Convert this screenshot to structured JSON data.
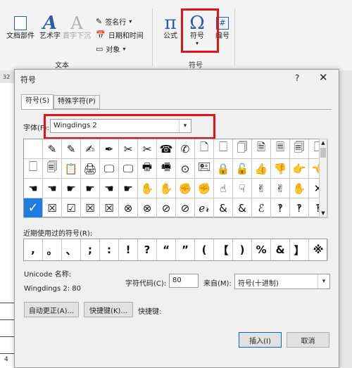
{
  "ribbon": {
    "doc_parts": "文档部件",
    "wordart": "艺术字",
    "dropcap": "首字下沉",
    "signature": "签名行",
    "datetime": "日期和时间",
    "object": "对象",
    "group_text": "文本",
    "equation": "公式",
    "symbol": "符号",
    "number": "编号",
    "group_symbols": "符号",
    "ruler_num": "32",
    "doc_frag": "4"
  },
  "dialog": {
    "title": "符号",
    "help": "?",
    "close": "✕",
    "tabs": [
      "符号(S)",
      "特殊字符(P)"
    ],
    "font_label": "字体(F):",
    "font_value": "Wingdings 2",
    "grid_rows": [
      [
        "",
        "✎",
        "✎",
        "✍",
        "✒",
        "✂",
        "✂",
        "☎",
        "✆",
        "🗋",
        "🗌",
        "🗍",
        "🗎",
        "🗏",
        "🗐",
        "🗋"
      ],
      [
        "🗌",
        "🗐",
        "📋",
        "🖨",
        "🖵",
        "🖵",
        "🖶",
        "🖷",
        "⊙",
        "🖭",
        "🔒",
        "🔓",
        "👍",
        "👎",
        "👉",
        "👈"
      ],
      [
        "☚",
        "☚",
        "☛",
        "☛",
        "☚",
        "☛",
        "✋",
        "✋",
        "✊",
        "✊",
        "☝",
        "☟",
        "✌",
        "✌",
        "✋",
        "✕"
      ],
      [
        "✓",
        "☒",
        "☑",
        "☒",
        "☒",
        "⊗",
        "⊗",
        "⊘",
        "⊘",
        "ℯ𝓇",
        "&",
        "&",
        "ℰ",
        "‽",
        "‽",
        "‽"
      ]
    ],
    "selected_cell": "0",
    "recent_label": "近期使用过的符号(R):",
    "recent_symbols": [
      ",",
      "。",
      "、",
      ";",
      ":",
      "!",
      "?",
      "“",
      "”",
      "(",
      "【",
      ")",
      "%",
      "&",
      "】",
      "※"
    ],
    "unicode_label": "Unicode 名称:",
    "unicode_value": "Wingdings 2: 80",
    "charcode_label": "字符代码(C):",
    "charcode_value": "80",
    "from_label": "来自(M):",
    "from_value": "符号(十进制)",
    "autocorrect": "自动更正(A)...",
    "shortcut_key": "快捷键(K)...",
    "shortcut_label": "快捷键:",
    "insert": "插入(I)",
    "cancel": "取消"
  }
}
